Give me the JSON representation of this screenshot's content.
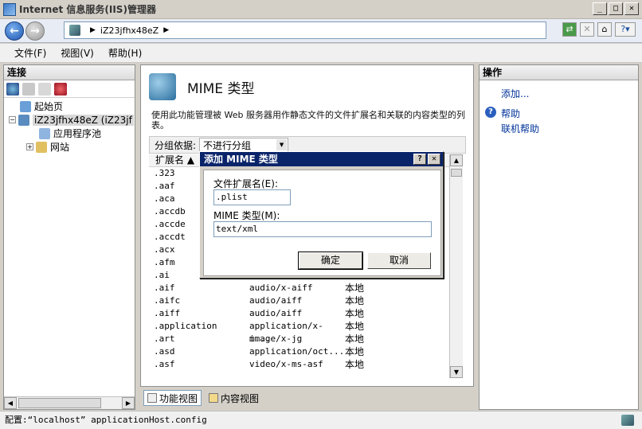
{
  "window": {
    "title": "Internet 信息服务(IIS)管理器"
  },
  "address": {
    "path": "iZ23jfhx48eZ"
  },
  "menu": [
    "文件(F)",
    "视图(V)",
    "帮助(H)"
  ],
  "left": {
    "header": "连接",
    "tree": [
      {
        "label": "起始页",
        "indent": 1,
        "expander": ""
      },
      {
        "label": "iZ23jfhx48eZ (iZ23jf",
        "indent": 0,
        "expander": "−"
      },
      {
        "label": "应用程序池",
        "indent": 2,
        "expander": ""
      },
      {
        "label": "网站",
        "indent": 2,
        "expander": "+"
      }
    ]
  },
  "center": {
    "title": "MIME 类型",
    "description": "使用此功能管理被 Web 服务器用作静态文件的文件扩展名和关联的内容类型的列表。",
    "group_label": "分组依据:",
    "group_value": "不进行分组",
    "column_ext": "扩展名",
    "rows": [
      {
        "ext": ".323",
        "mime": "",
        "type": ""
      },
      {
        "ext": ".aaf",
        "mime": "",
        "type": ""
      },
      {
        "ext": ".aca",
        "mime": "",
        "type": ""
      },
      {
        "ext": ".accdb",
        "mime": "",
        "type": ""
      },
      {
        "ext": ".accde",
        "mime": "",
        "type": ""
      },
      {
        "ext": ".accdt",
        "mime": "",
        "type": ""
      },
      {
        "ext": ".acx",
        "mime": "",
        "type": ""
      },
      {
        "ext": ".afm",
        "mime": "",
        "type": ""
      },
      {
        "ext": ".ai",
        "mime": "",
        "type": ""
      },
      {
        "ext": ".aif",
        "mime": "audio/x-aiff",
        "type": "本地"
      },
      {
        "ext": ".aifc",
        "mime": "audio/aiff",
        "type": "本地"
      },
      {
        "ext": ".aiff",
        "mime": "audio/aiff",
        "type": "本地"
      },
      {
        "ext": ".application",
        "mime": "application/x-m...",
        "type": "本地"
      },
      {
        "ext": ".art",
        "mime": "image/x-jg",
        "type": "本地"
      },
      {
        "ext": ".asd",
        "mime": "application/oct...",
        "type": "本地"
      },
      {
        "ext": ".asf",
        "mime": "video/x-ms-asf",
        "type": "本地"
      }
    ],
    "tab_features": "功能视图",
    "tab_content": "内容视图"
  },
  "right": {
    "header": "操作",
    "add": "添加...",
    "help": "帮助",
    "online_help": "联机帮助"
  },
  "status": {
    "text": "配置:“localhost” applicationHost.config"
  },
  "dialog": {
    "title": "添加 MIME 类型",
    "ext_label": "文件扩展名(E):",
    "ext_value": ".plist",
    "mime_label": "MIME 类型(M):",
    "mime_value": "text/xml",
    "ok": "确定",
    "cancel": "取消",
    "help_btn": "?",
    "close_btn": "✕"
  }
}
